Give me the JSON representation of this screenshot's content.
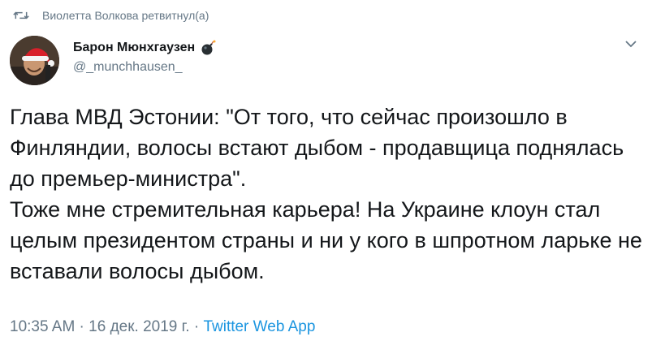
{
  "retweet": {
    "text": "Виолетта Волкова ретвитнул(а)",
    "icon": "retweet-icon"
  },
  "author": {
    "display_name": "Барон Мюнхгаузен",
    "handle": "@_munchhausen_",
    "badge_icon": "bomb-icon",
    "avatar_icon": "avatar-santa-hat"
  },
  "menu_icon": "chevron-down-icon",
  "tweet": {
    "paragraph1": "Глава МВД Эстонии: \"От того, что сейчас произошло в Финляндии, волосы встают дыбом - продавщица поднялась до премьер-министра\".",
    "paragraph2": "Тоже мне стремительная карьера! На Украине клоун стал целым президентом страны и ни у кого в шпротном ларьке не вставали волосы дыбом."
  },
  "meta": {
    "time": "10:35 AM",
    "separator": " · ",
    "date": "16 дек. 2019 г.",
    "source": "Twitter Web App"
  },
  "colors": {
    "text": "#14171a",
    "secondary": "#657786",
    "link": "#1b95e0"
  }
}
